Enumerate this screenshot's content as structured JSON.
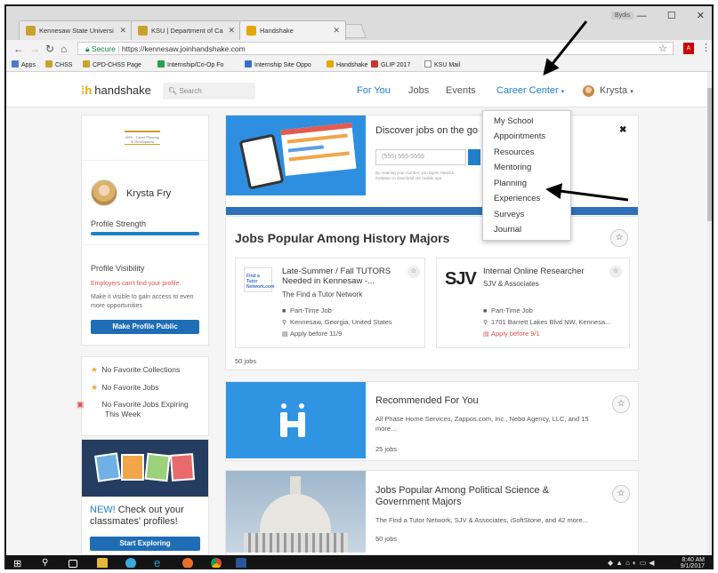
{
  "browser": {
    "tabs": [
      {
        "title": "Kennesaw State Universi"
      },
      {
        "title": "KSU | Department of Ca"
      },
      {
        "title": "Handshake"
      }
    ],
    "user_badge": "Bydis",
    "secure_label": "Secure",
    "url": "https://kennesaw.joinhandshake.com",
    "bookmarks": [
      "Apps",
      "CHSS",
      "CPD-CHSS Page",
      "Internship/Co-Op Fo",
      "Internship Site Oppo",
      "Handshake",
      "GLIP 2017",
      "KSU Mail"
    ]
  },
  "header": {
    "logo": "handshake",
    "search_placeholder": "Search",
    "nav": {
      "for_you": "For You",
      "jobs": "Jobs",
      "events": "Events",
      "career_center": "Career Center",
      "user": "Krysta"
    }
  },
  "dropdown": {
    "items": [
      "My School",
      "Appointments",
      "Resources",
      "Mentoring",
      "Planning",
      "Experiences",
      "Surveys",
      "Journal"
    ]
  },
  "sidebar": {
    "profile_name": "Krysta Fry",
    "profile_strength": "Profile Strength",
    "profile_strength_value": 1.0,
    "visibility_title": "Profile Visibility",
    "visibility_warning": "Employers can't find your profile.",
    "visibility_hint": "Make it visible to gain access to even more opportunities",
    "make_public_button": "Make Profile Public",
    "favorites": [
      "No Favorite Collections",
      "No Favorite Jobs",
      "No Favorite Jobs Expiring This Week"
    ],
    "promo_new": "NEW!",
    "promo_text": "Check out your classmates' profiles!",
    "promo_button": "Start Exploring"
  },
  "main": {
    "discover": {
      "title": "Discover jobs on the go",
      "phone_placeholder": "(555) 555-5555",
      "fine_print_left": "By entering your number, you agree Handsh",
      "fine_print_right": "nd send you an",
      "fine_print_line2": "invitation to download our mobile app."
    },
    "history": {
      "title": "Jobs Popular Among History Majors",
      "jobs": [
        {
          "logo_text": "Find a Tutor Network.com",
          "title": "Late-Summer / Fall TUTORS Needed in Kennesaw -...",
          "company": "The Find a Tutor Network",
          "type": "Part-Time Job",
          "location": "Kennesaw, Georgia, United States",
          "apply": "Apply before 11/9"
        },
        {
          "logo_text": "SJV",
          "title": "Internal Online Researcher",
          "company": "SJV & Associates",
          "type": "Part-Time Job",
          "location": "1701 Barrett Lakes Blvd NW, Kennesa...",
          "apply": "Apply before 9/1"
        }
      ],
      "count": "50 jobs"
    },
    "recommended": {
      "title": "Recommended For You",
      "subtitle": "All Phase Home Services, Zappos.com, Inc., Nebo Agency, LLC, and 15 more...",
      "count": "25 jobs"
    },
    "polisci": {
      "title": "Jobs Popular Among Political Science & Government Majors",
      "subtitle": "The Find a Tutor Network, SJV & Associates, iSoftStone, and 42 more...",
      "count": "50 jobs"
    }
  },
  "taskbar": {
    "time": "8:40 AM",
    "date": "9/1/2017"
  },
  "colors": {
    "accent_blue": "#1f80c7",
    "button_blue": "#1f6db5",
    "warning_red": "#d9534f",
    "brand_yellow": "#e6a800"
  }
}
